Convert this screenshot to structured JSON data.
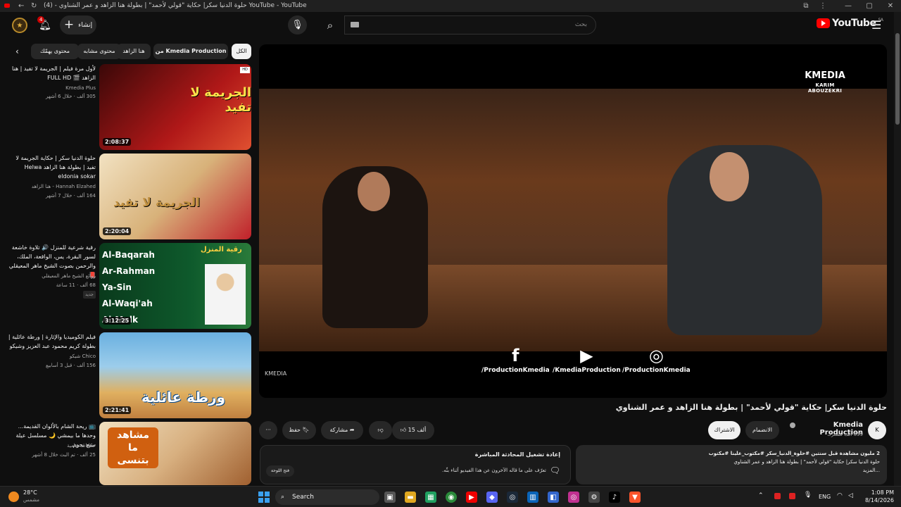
{
  "window": {
    "title": "حلوة الدنيا سكر| حكاية \"قولي لأحمد\" | بطولة هنا الزاهد و عمر الشناوي - (4) YouTube - YouTube"
  },
  "header": {
    "create_label": "إنشاء",
    "notification_count": "4",
    "search_placeholder": "بحث",
    "logo_text": "YouTube",
    "logo_region": "SA"
  },
  "chips": [
    "الكل",
    "من Kmedia Production",
    "هنا الزاهد",
    "محتوى مشابه",
    "محتوى يهمّك"
  ],
  "recommendations": [
    {
      "title": "لأول مرة فيلم | الجريمة لا تفيد | هنا الزاهد 🎬 FULL HD",
      "channel": "Kmedia Plus",
      "meta": "305 ألف · خلال 6 أشهر",
      "duration": "2:08:37",
      "thumb_text": "الجريمة لا تفيد",
      "thumb_color": "#b01818"
    },
    {
      "title": "حلوة الدنيا سكر | حكاية الجريمة لا تفيد | بطولة هنا الزاهد Helwa eldonia sokar",
      "channel": "Hannah Elzahed - هنا الزاهد",
      "meta": "164 ألف · خلال 7 أشهر",
      "duration": "2:20:04",
      "thumb_text": "الجريمة لا تفيد",
      "thumb_color": "#c0202a"
    },
    {
      "title": "رقية شرعية للمنزل 🔊 تلاوة خاشعة لسور البقرة، يس، الواقعة، الملك، والرحمن بصوت الشيخ ماهر المعيقلي 📕",
      "channel": "روائع الشيخ ماهر المعيقلي",
      "meta": "68 ألف · 11 ساعة",
      "badge": "جديد",
      "duration": "3:12:25",
      "thumb_text": "رقية المنزل",
      "thumb_color": "#0e5a2c",
      "surahs": [
        "Al-Baqarah",
        "Ar-Rahman",
        "Ya-Sin",
        "Al-Waqi'ah",
        "Al-Mulk"
      ]
    },
    {
      "title": "فيلم الكوميديا والإثارة | ورطة عائلية | بطولة كريم محمود عبد العزيز وشيكو",
      "channel": "Chico شيكو",
      "meta": "156 ألف · قبل 3 أسابيع",
      "duration": "2:21:41",
      "thumb_text": "ورطة عائلية",
      "thumb_color": "#d8a044"
    },
    {
      "title": "📺 ريحة الشام بالألوان القديمة... وحدها ما بيمشي 🌙 مسلسل عيلة سبع نجوم",
      "channel": "حكايات شامية",
      "meta": "25 ألف · تم البث خلال 8 أشهر",
      "duration": "",
      "thumb_text": "مشاهد ما بتنسى",
      "thumb_color": "#d06010"
    }
  ],
  "player": {
    "brand": "KMEDIA",
    "brand_sub": "KARIM ABOUZEKRI",
    "socials": [
      {
        "icon": "facebook-icon",
        "glyph": "f",
        "label": "/ProductionKmedia"
      },
      {
        "icon": "youtube-icon",
        "glyph": "▶",
        "label": "/KmediaProduction"
      },
      {
        "icon": "instagram-icon",
        "glyph": "◎",
        "label": "/ProductionKmedia"
      }
    ],
    "watermark": "KMEDIA"
  },
  "video": {
    "title": "حلوة الدنيا سكر| حكاية \"قولي لأحمد\" | بطولة هنا الزاهد و عمر الشناوي",
    "channel": "Kmedia Production",
    "subscribers": "699 ألف مشترك",
    "join_label": "الانضمام",
    "subscribe_label": "الاشتراك",
    "likes": "15 ألف",
    "share_label": "مشاركة",
    "save_label": "حفظ",
    "more": "···"
  },
  "description": {
    "stats": "2 مليون مشاهدة  قبل سنتين  #حلوة_الدنيا_سكر #مكتوب_علينا #مكتوب",
    "line2": "حلوة الدنيا سكر| حكاية \"قولي لأحمد\" | بطولة هنا الزاهد و عمر الشناوي",
    "more": "...المزيد"
  },
  "chat": {
    "title": "إعادة تشغيل المحادثة المباشرة",
    "text": "تعرّف على ما قاله الآخرون عن هذا الفيديو أثناء بثّه.",
    "button": "فتح اللوحة"
  },
  "taskbar": {
    "weather_temp": "28°C",
    "weather_desc": "مشمس",
    "search_label": "Search",
    "lang": "ENG",
    "time": "1:08 PM",
    "date": "8/14/2026"
  }
}
